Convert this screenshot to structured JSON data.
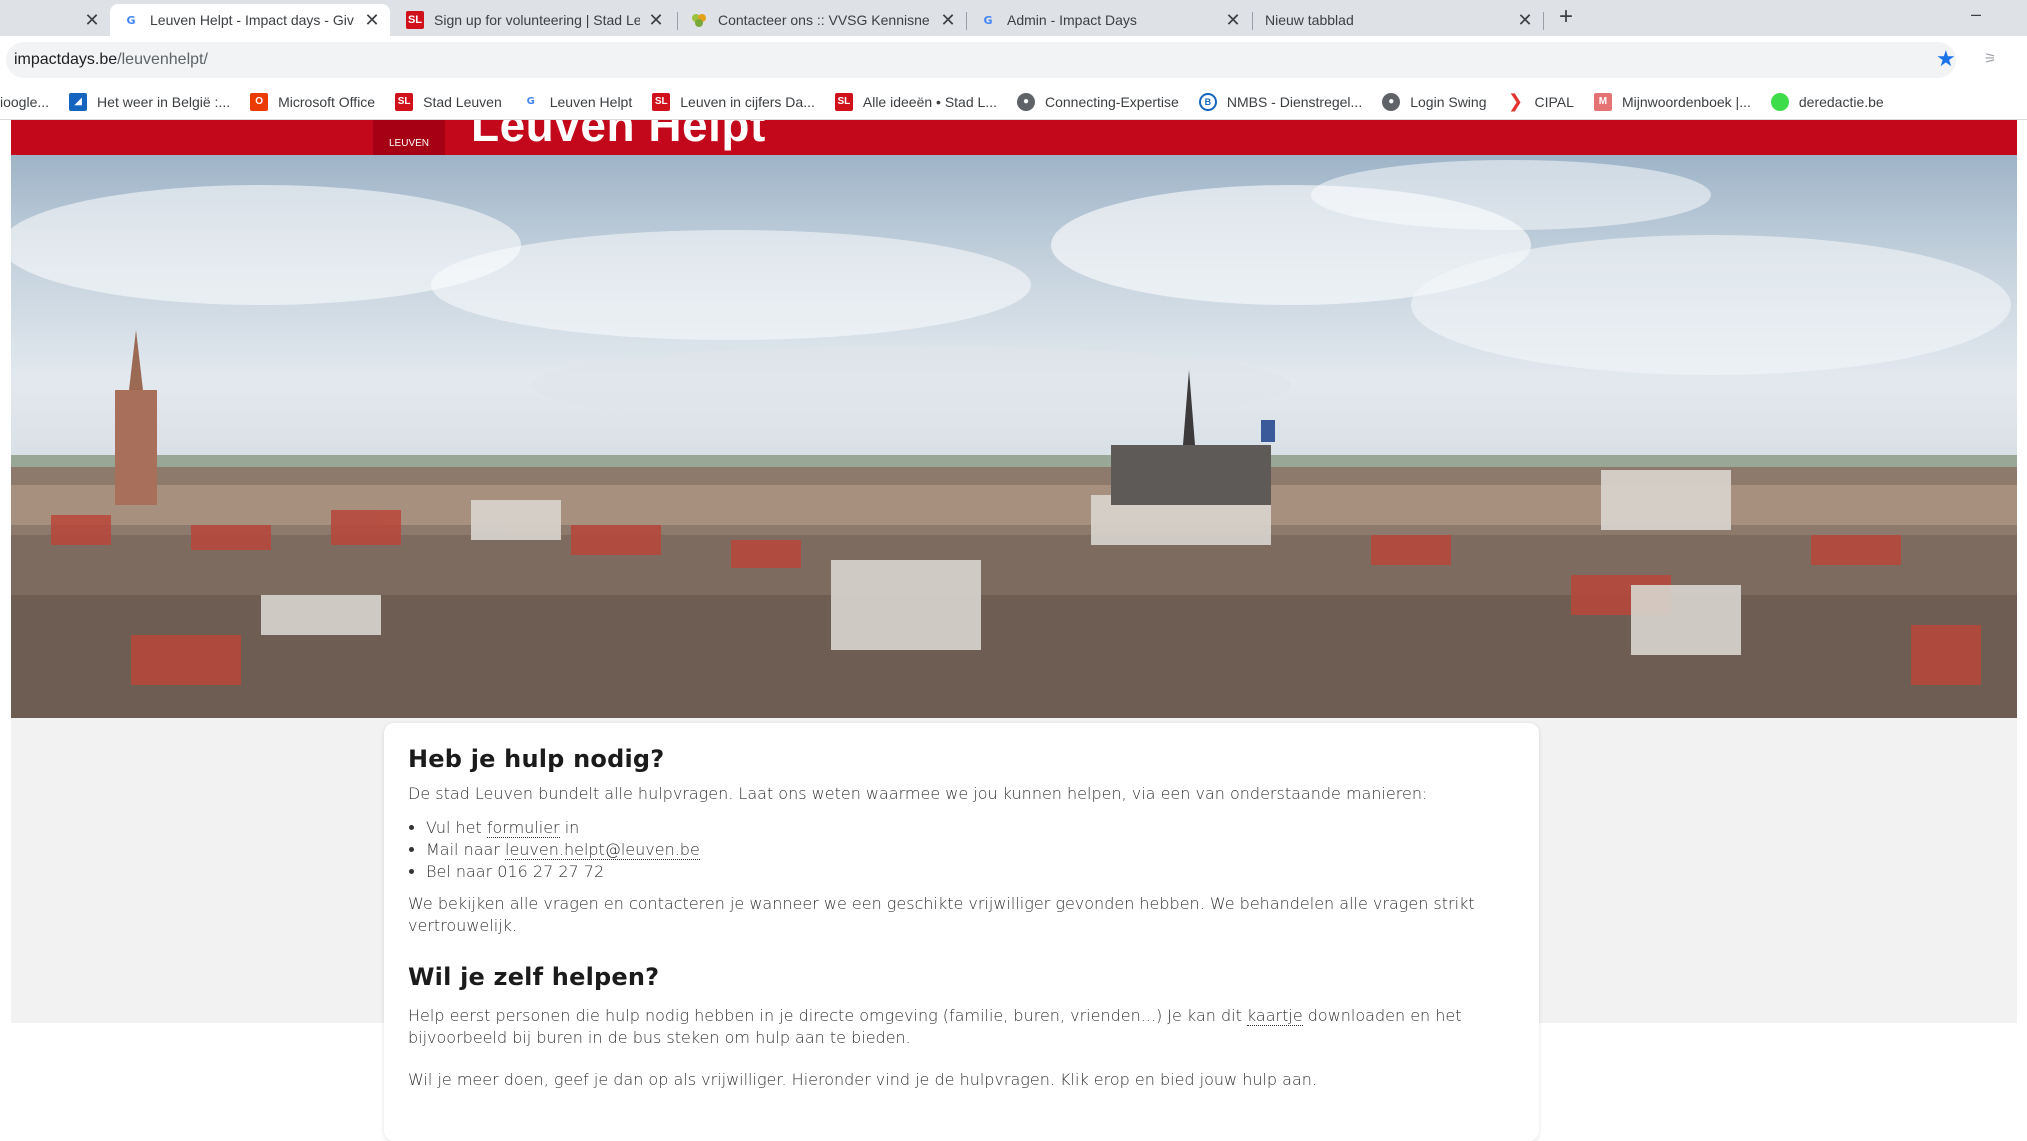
{
  "tabs": [
    {
      "title": "",
      "favicon": "none",
      "active": false
    },
    {
      "title": "Leuven Helpt - Impact days - Giv",
      "favicon": "g-logo",
      "active": true
    },
    {
      "title": "Sign up for volunteering | Stad Le",
      "favicon": "sl-logo",
      "active": false
    },
    {
      "title": "Contacteer ons :: VVSG Kennisne",
      "favicon": "leaf-icon",
      "active": false
    },
    {
      "title": "Admin - Impact Days",
      "favicon": "g-logo",
      "active": false
    },
    {
      "title": "Nieuw tabblad",
      "favicon": "none",
      "active": false
    }
  ],
  "window": {
    "new_tab": "+",
    "minimize": "–",
    "close_glyph": "✕"
  },
  "address": {
    "host": "impactdays.be",
    "path": "/leuvenhelpt/"
  },
  "bookmarks": [
    {
      "label": "ioogle...",
      "icon": "none"
    },
    {
      "label": "Het weer in België :...",
      "icon": "weather-icon"
    },
    {
      "label": "Microsoft Office",
      "icon": "office-icon"
    },
    {
      "label": "Stad Leuven",
      "icon": "sl-logo"
    },
    {
      "label": "Leuven Helpt",
      "icon": "g-logo"
    },
    {
      "label": "Leuven in cijfers Da...",
      "icon": "sl-logo"
    },
    {
      "label": "Alle ideeën • Stad L...",
      "icon": "sl-logo"
    },
    {
      "label": "Connecting-Expertise",
      "icon": "globe-icon"
    },
    {
      "label": "NMBS - Dienstregel...",
      "icon": "nmbs-icon"
    },
    {
      "label": "Login Swing",
      "icon": "globe-icon"
    },
    {
      "label": "CIPAL",
      "icon": "cipal-icon"
    },
    {
      "label": "Mijnwoordenboek |...",
      "icon": "m-icon"
    },
    {
      "label": "deredactie.be",
      "icon": "green-icon"
    }
  ],
  "site": {
    "title": "Leuven Helpt",
    "logo_text": "LEUVEN"
  },
  "content": {
    "heading1": "Heb je hulp nodig?",
    "intro": "De stad Leuven bundelt alle hulpvragen. Laat ons weten waarmee we jou kunnen helpen, via een van onderstaande manieren:",
    "list": {
      "item1_pre": "Vul het ",
      "item1_link": "formulier",
      "item1_post": " in",
      "item2_pre": "Mail naar ",
      "item2_link": "leuven.helpt@leuven.be",
      "item3": "Bel naar 016 27 27 72"
    },
    "after_list": "We bekijken alle vragen en contacteren je wanneer we een geschikte vrijwilliger gevonden hebben. We behandelen alle vragen strikt vertrouwelijk.",
    "heading2": "Wil je zelf helpen?",
    "help1_pre": "Help eerst personen die hulp nodig hebben in je directe omgeving (familie, buren, vrienden...) Je kan dit ",
    "help1_link": "kaartje",
    "help1_post": " downloaden en het bijvoorbeeld bij buren in de bus steken om hulp aan te bieden.",
    "help2": "Wil je meer doen, geef je dan op als vrijwilliger. Hieronder vind je de hulpvragen. Klik erop en bied jouw hulp aan."
  },
  "colors": {
    "brand_red": "#c4081b",
    "star_blue": "#1a73e8"
  }
}
